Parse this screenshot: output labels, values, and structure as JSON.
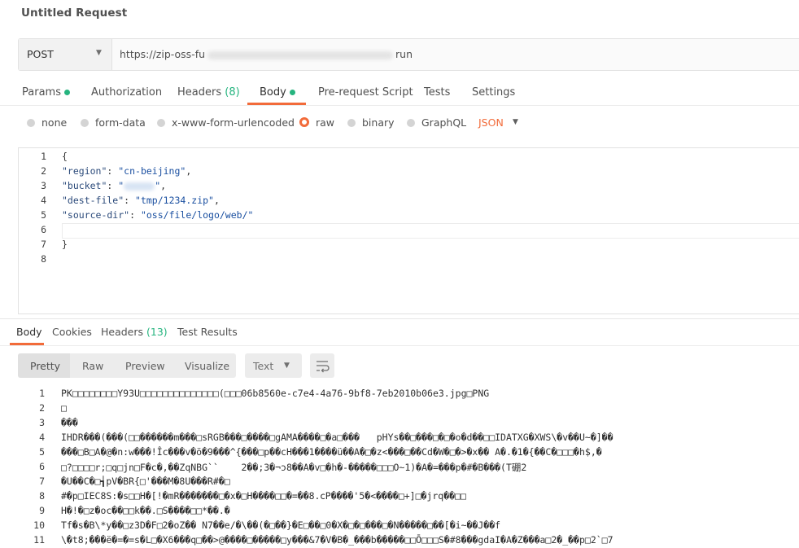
{
  "title": "Untitled Request",
  "request": {
    "method": "POST",
    "url_prefix": "https://zip-oss-fu",
    "url_suffix": "run"
  },
  "request_tabs": [
    {
      "label": "Params",
      "dot": true
    },
    {
      "label": "Authorization"
    },
    {
      "label": "Headers",
      "count": "(8)"
    },
    {
      "label": "Body",
      "dot": true,
      "active": true
    },
    {
      "label": "Pre-request Script"
    },
    {
      "label": "Tests"
    },
    {
      "label": "Settings"
    }
  ],
  "body_types": [
    "none",
    "form-data",
    "x-www-form-urlencoded",
    "raw",
    "binary",
    "GraphQL"
  ],
  "body_type_selected": "raw",
  "format_selected": "JSON",
  "editor": {
    "line_numbers": [
      "1",
      "2",
      "3",
      "4",
      "5",
      "6",
      "7",
      "8"
    ],
    "open_brace": "{",
    "close_brace": "}",
    "k_region": "\"region\"",
    "v_region": "\"cn-beijing\"",
    "k_bucket": "\"bucket\"",
    "v_bucket_q1": "\"",
    "v_bucket_q2": "\"",
    "k_dest": "\"dest-file\"",
    "v_dest": "\"tmp/1234.zip\"",
    "k_source": "\"source-dir\"",
    "v_source": "\"oss/file/logo/web/\"",
    "colon": ": ",
    "comma": ","
  },
  "response_tabs": [
    {
      "label": "Body",
      "active": true
    },
    {
      "label": "Cookies"
    },
    {
      "label": "Headers",
      "count": "(13)"
    },
    {
      "label": "Test Results"
    }
  ],
  "view_modes": [
    "Pretty",
    "Raw",
    "Preview",
    "Visualize"
  ],
  "view_mode_selected": "Pretty",
  "response_format": "Text",
  "response": {
    "line_numbers": [
      "1",
      "2",
      "3",
      "4",
      "5",
      "6",
      "7",
      "8",
      "9",
      "10",
      "11"
    ],
    "lines": [
      "PK□□□□□□□□Y93U□□□□□□□□□□□□□□(□□□06b8560e-c7e4-4a76-9bf8-7eb2010b06e3.jpg□PNG",
      "□",
      "���",
      "IHDR���(���(□□������m���□sRGB���□����□gAMA����□�a□���   pHYs��□���□�□�o�d��□□IDATXG�XWS\\�v��U~�]��",
      "���□B□A�@�n:w���!Îc���v�ö�9���^{���□p��cH���1����ü��A�□�z<���□��Cd�W�□�>�x�� A�.�1�{��C�□□□�h$,�",
      "□?□□□□r;□q□jn□F�c�,��ZqNBG``    2��;3�¬ɔ8��A�v□�h�-�����□□□O~1)�A�=���p�#�B���(T硼2",
      "�U��C�□┪pV�BR{□'���M�8U���R#�□",
      "#�p□IEC8S:�s□□H�[!�mR�������□�x�□H����□□�=��8.ⅽP����'5�<����□+]□�jrq��□□",
      "H�!�□z�oc��□□k��.□S����□□*��.�",
      "Tf�s�B\\*y��□z3D�F□2�oZ�� N7��e/�\\��(�□��}�E□��□0�X�□�□���□�N�����□��[�i~��J��f",
      "\\�t8;���ë�=�=s�L□�X6���q□��>@����□�����□y���&7�V�B�_���b�����□□Ō□□□S�#8���gdaI�A�Z���a□2�_��p□2`□7"
    ]
  }
}
